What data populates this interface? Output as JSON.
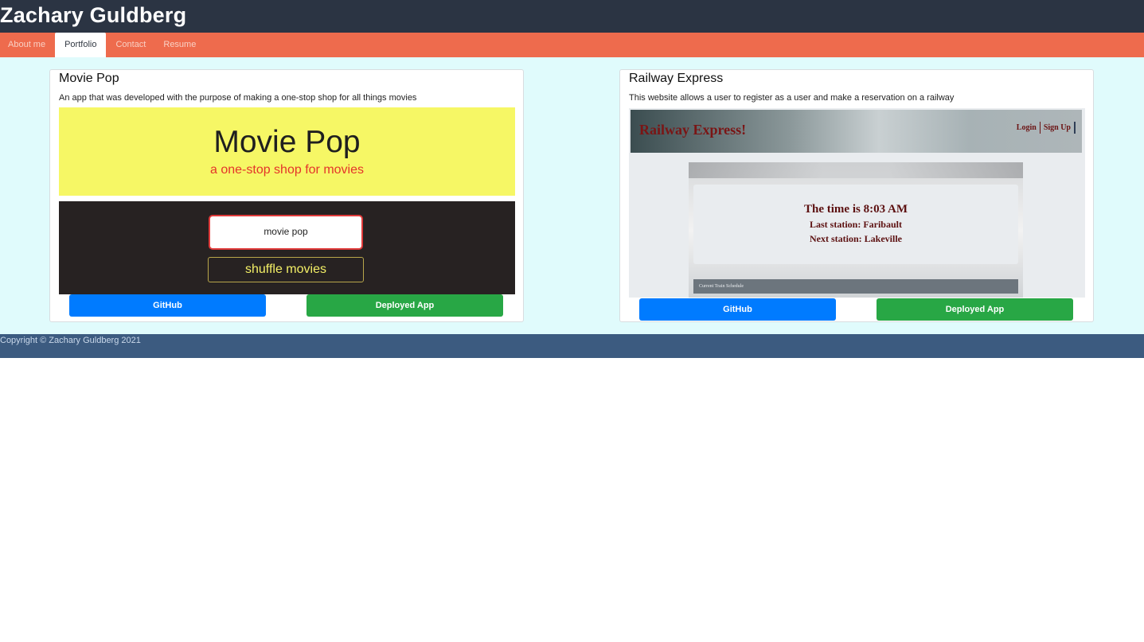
{
  "header": {
    "title": "Zachary Guldberg"
  },
  "nav": {
    "tabs": [
      {
        "label": "About me",
        "active": false
      },
      {
        "label": "Portfolio",
        "active": true
      },
      {
        "label": "Contact",
        "active": false
      },
      {
        "label": "Resume",
        "active": false
      }
    ]
  },
  "projects": [
    {
      "title": "Movie Pop",
      "description": "An app that was developed with the purpose of making a one-stop shop for all things movies",
      "preview": {
        "logo": "Movie Pop",
        "tagline": "a one-stop shop for movies",
        "search_value": "movie pop",
        "shuffle_label": "shuffle movies"
      },
      "github_label": "GitHub",
      "deploy_label": "Deployed App"
    },
    {
      "title": "Railway Express",
      "description": "This website allows a user to register as a user and make a reservation on a railway",
      "preview": {
        "brand": "Railway Express!",
        "login": "Login",
        "signup": "Sign Up",
        "time_text": "The time is 8:03 AM",
        "last_station": "Last station: Faribault",
        "next_station": "Next station: Lakeville",
        "schedule_label": "Current Train Schedule"
      },
      "github_label": "GitHub",
      "deploy_label": "Deployed App"
    }
  ],
  "footer": {
    "copyright": "Copyright © Zachary Guldberg 2021"
  },
  "colors": {
    "header_bg": "#2b3443",
    "nav_bg": "#ee6b4d",
    "main_bg": "#e0fbfc",
    "footer_bg": "#3c5b80",
    "github_button": "#007bff",
    "deploy_button": "#28a745"
  }
}
